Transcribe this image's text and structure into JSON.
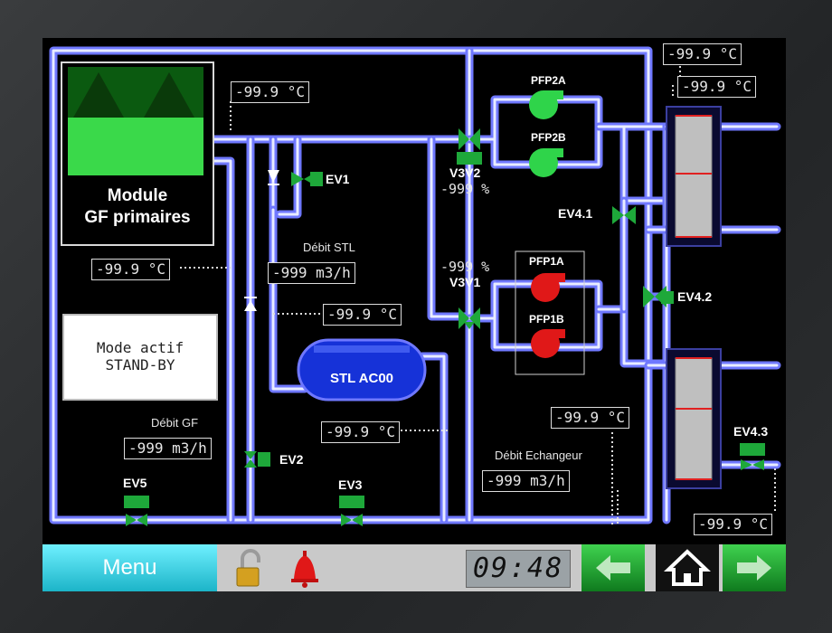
{
  "module": {
    "title_line1": "Module",
    "title_line2": "GF primaires"
  },
  "mode": {
    "line1": "Mode actif",
    "line2": "STAND-BY"
  },
  "tank": {
    "label": "STL AC00"
  },
  "values": {
    "temp_module_out": "-99.9 °C",
    "temp_return_left": "-99.9 °C",
    "temp_mid": "-99.9 °C",
    "temp_tank_out": "-99.9 °C",
    "temp_hx_top1": "-99.9 °C",
    "temp_hx_top2": "-99.9 °C",
    "temp_hx_mid": "-99.9 °C",
    "temp_hx_bottom": "-99.9 °C",
    "debit_stl": "-999 m3/h",
    "debit_gf": "-999 m3/h",
    "debit_echangeur": "-999 m3/h",
    "v3v2_pct": "-999 %",
    "v3v1_pct": "-999 %"
  },
  "labels": {
    "debit_stl": "Débit STL",
    "debit_gf": "Débit GF",
    "debit_echangeur": "Débit Echangeur",
    "ev1": "EV1",
    "ev2": "EV2",
    "ev3": "EV3",
    "ev5": "EV5",
    "ev41": "EV4.1",
    "ev42": "EV4.2",
    "ev43": "EV4.3",
    "v3v1": "V3V1",
    "v3v2": "V3V2",
    "pfp1a": "PFP1A",
    "pfp1b": "PFP1B",
    "pfp2a": "PFP2A",
    "pfp2b": "PFP2B"
  },
  "statusbar": {
    "menu_label": "Menu",
    "clock": "09:48"
  },
  "icons": {
    "lock": "padlock-open-icon",
    "alarm": "bell-icon",
    "prev": "arrow-left-icon",
    "home": "home-icon",
    "next": "arrow-right-icon"
  },
  "colors": {
    "pipe": "#6f78ff",
    "pump_on": "#2fd44a",
    "pump_off": "#e01818",
    "valve": "#1ea83a",
    "menu": "#1cb4c8",
    "nav": "#1a9a2a",
    "module": "#3ad94a"
  }
}
